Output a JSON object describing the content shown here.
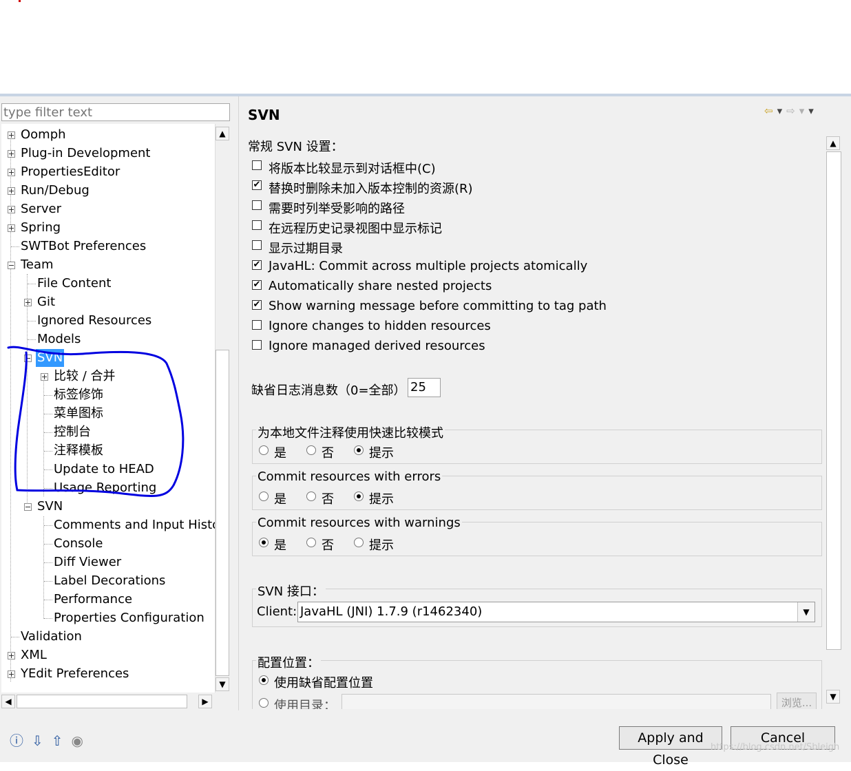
{
  "filter": {
    "placeholder": "type filter text"
  },
  "tree": {
    "items": [
      {
        "label": "Oomph"
      },
      {
        "label": "Plug-in Development"
      },
      {
        "label": "PropertiesEditor"
      },
      {
        "label": "Run/Debug"
      },
      {
        "label": "Server"
      },
      {
        "label": "Spring"
      },
      {
        "label": "SWTBot Preferences"
      },
      {
        "label": "Team"
      },
      {
        "label": "File Content"
      },
      {
        "label": "Git"
      },
      {
        "label": "Ignored Resources"
      },
      {
        "label": "Models"
      },
      {
        "label": "SVN"
      },
      {
        "label": "比较 / 合并"
      },
      {
        "label": "标签修饰"
      },
      {
        "label": "菜单图标"
      },
      {
        "label": "控制台"
      },
      {
        "label": "注释模板"
      },
      {
        "label": "Update to HEAD"
      },
      {
        "label": "Usage Reporting"
      },
      {
        "label": "SVN"
      },
      {
        "label": "Comments and Input Histo"
      },
      {
        "label": "Console"
      },
      {
        "label": "Diff Viewer"
      },
      {
        "label": "Label Decorations"
      },
      {
        "label": "Performance"
      },
      {
        "label": "Properties Configuration"
      },
      {
        "label": "Validation"
      },
      {
        "label": "XML"
      },
      {
        "label": "YEdit Preferences"
      }
    ]
  },
  "page": {
    "title": "SVN",
    "general_label": "常规 SVN 设置：",
    "checkboxes": [
      {
        "label": "将版本比较显示到对话框中(C)",
        "checked": false
      },
      {
        "label": "替换时删除未加入版本控制的资源(R)",
        "checked": true
      },
      {
        "label": "需要时列举受影响的路径",
        "checked": false
      },
      {
        "label": "在远程历史记录视图中显示标记",
        "checked": false
      },
      {
        "label": "显示过期目录",
        "checked": false
      },
      {
        "label": "JavaHL: Commit across multiple projects atomically",
        "checked": true
      },
      {
        "label": "Automatically share nested projects",
        "checked": true
      },
      {
        "label": "Show warning message before committing to tag path",
        "checked": true
      },
      {
        "label": "Ignore changes to hidden resources",
        "checked": false
      },
      {
        "label": "Ignore managed derived resources",
        "checked": false
      }
    ],
    "check_mark": "✔",
    "log_count": {
      "label": "缺省日志消息数（0=全部）",
      "value": "25"
    },
    "radio_groups": [
      {
        "title": "为本地文件注释使用快速比较模式",
        "options": [
          "是",
          "否",
          "提示"
        ],
        "selected": 2
      },
      {
        "title": "Commit resources with errors",
        "options": [
          "是",
          "否",
          "提示"
        ],
        "selected": 2
      },
      {
        "title": "Commit resources with warnings",
        "options": [
          "是",
          "否",
          "提示"
        ],
        "selected": 0
      }
    ],
    "svn_interface": {
      "title": "SVN 接口：",
      "client_label": "Client:",
      "client_value": "JavaHL (JNI) 1.7.9 (r1462340)"
    },
    "config_location": {
      "title": "配置位置：",
      "use_default": "使用缺省配置位置",
      "use_dir": "使用目录：",
      "browse": "浏览..."
    }
  },
  "buttons": {
    "apply_close": "Apply and Close",
    "cancel": "Cancel"
  },
  "watermark": "https://blog.csdn.net/Sbleigh",
  "annotation_color": "#0000e0"
}
